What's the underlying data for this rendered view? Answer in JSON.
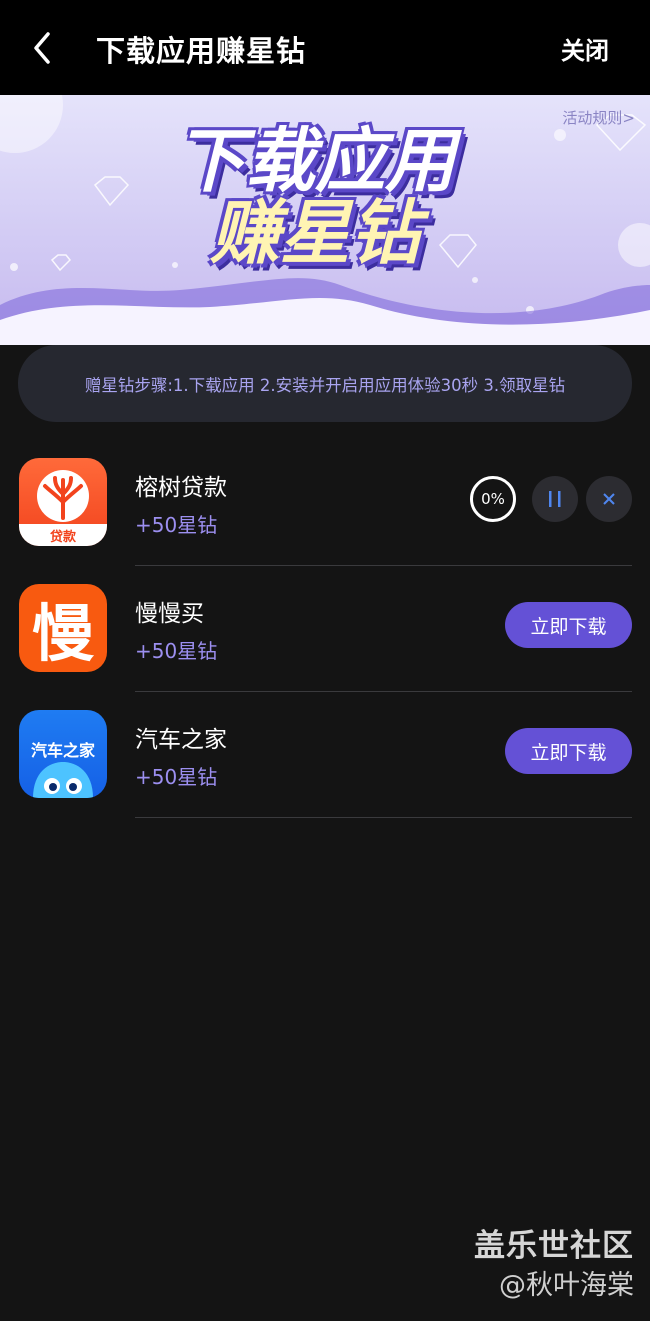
{
  "header": {
    "title": "下载应用赚星钻",
    "close_label": "关闭"
  },
  "banner": {
    "title_line1": "下载应用",
    "title_line2": "赚星钻",
    "rules_link": "活动规则>"
  },
  "tip": {
    "text": "赠星钻步骤:1.下载应用 2.安装并开启用应用体验30秒 3.领取星钻"
  },
  "apps": [
    {
      "name": "榕树贷款",
      "reward": "+50星钻",
      "icon_label": "贷款",
      "state": "downloading",
      "progress": "0%"
    },
    {
      "name": "慢慢买",
      "reward": "+50星钻",
      "icon_glyph": "慢",
      "state": "idle",
      "button_label": "立即下载"
    },
    {
      "name": "汽车之家",
      "reward": "+50星钻",
      "icon_label": "汽车之家",
      "state": "idle",
      "button_label": "立即下载"
    }
  ],
  "watermark": {
    "line1": "盖乐世社区",
    "line2": "@秋叶海棠"
  },
  "colors": {
    "accent": "#6451d6",
    "reward_text": "#9c8ff0",
    "background": "#141414"
  }
}
